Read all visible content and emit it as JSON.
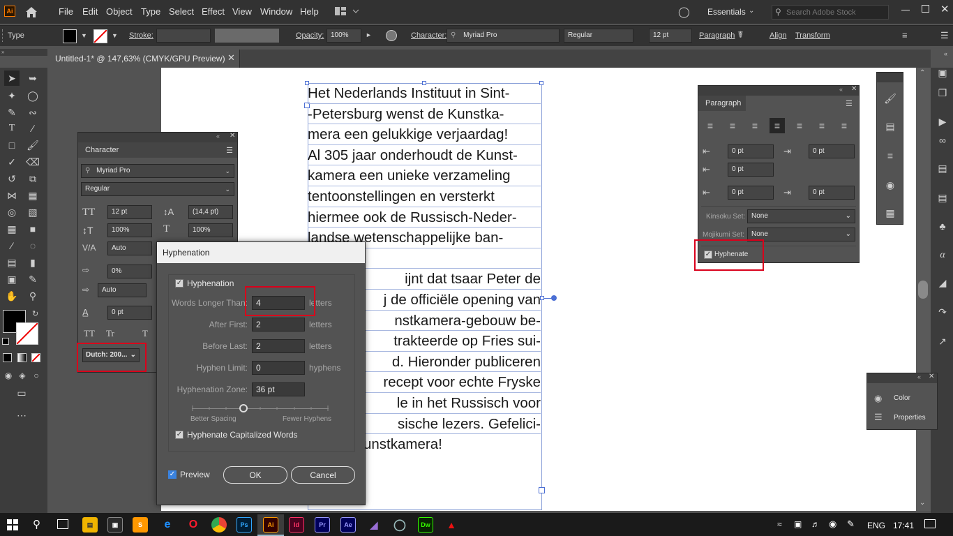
{
  "app": {
    "logo": "Ai",
    "workspace": "Essentials",
    "search_placeholder": "Search Adobe Stock"
  },
  "menu": [
    "File",
    "Edit",
    "Object",
    "Type",
    "Select",
    "Effect",
    "View",
    "Window",
    "Help"
  ],
  "control_bar": {
    "type_label": "Type",
    "stroke_label": "Stroke:",
    "opacity_label": "Opacity:",
    "opacity_value": "100%",
    "character_label": "Character:",
    "font": "Myriad Pro",
    "style": "Regular",
    "size": "12 pt",
    "paragraph_label": "Paragraph",
    "align_label": "Align",
    "transform_label": "Transform"
  },
  "document_tab": {
    "title": "Untitled-1* @ 147,63% (CMYK/GPU Preview)"
  },
  "artboard_text": [
    "Het Nederlands Instituut in Sint-",
    "-Petersburg wenst de Kunstka-",
    "mera een gelukkige verjaardag!",
    "Al 305 jaar onderhoudt de Kunst-",
    "kamera een unieke verzameling",
    "tentoonstellingen en versterkt",
    "hiermee ook de Russisch-Neder-",
    "landse wetenschappelijke ban-",
    "",
    "ijnt dat tsaar Peter de",
    "j de officiële opening van",
    "nstkamera-gebouw be-",
    "trakteerde op Fries sui-",
    "d. Hieronder publiceren",
    "recept voor echte Fryske",
    "le in het Russisch voor",
    "sische lezers. Gefelici-",
    "unstkamera!"
  ],
  "character_panel": {
    "title": "Character",
    "font": "Myriad Pro",
    "style": "Regular",
    "size": "12 pt",
    "leading": "(14,4 pt)",
    "vscale": "100%",
    "hscale": "100%",
    "kerning": "Auto",
    "tracking": "0%",
    "auto": "Auto",
    "baseline": "0 pt",
    "tt1": "TT",
    "tt2": "Tr",
    "language": "Dutch: 200..."
  },
  "hyphenation_dialog": {
    "title": "Hyphenation",
    "hyphenation_label": "Hyphenation",
    "rows": [
      {
        "label": "Words Longer Than:",
        "value": "4",
        "unit": "letters"
      },
      {
        "label": "After First:",
        "value": "2",
        "unit": "letters"
      },
      {
        "label": "Before Last:",
        "value": "2",
        "unit": "letters"
      },
      {
        "label": "Hyphen Limit:",
        "value": "0",
        "unit": "hyphens"
      },
      {
        "label": "Hyphenation Zone:",
        "value": "36 pt",
        "unit": ""
      }
    ],
    "better_spacing": "Better Spacing",
    "fewer_hyphens": "Fewer Hyphens",
    "slider_level": 0.38,
    "capitalized_label": "Hyphenate Capitalized Words",
    "preview_label": "Preview",
    "ok_label": "OK",
    "cancel_label": "Cancel"
  },
  "paragraph_panel": {
    "title": "Paragraph",
    "left_indent": "0 pt",
    "right_indent": "0 pt",
    "first_indent": "0 pt",
    "space_before": "0 pt",
    "space_after": "0 pt",
    "kinsoku_label": "Kinsoku Set:",
    "kinsoku_value": "None",
    "mojikumi_label": "Mojikumi Set:",
    "mojikumi_value": "None",
    "hyphenate_label": "Hyphenate"
  },
  "color_panel": {
    "color": "Color",
    "properties": "Properties"
  },
  "taskbar": {
    "language": "ENG",
    "time": "17:41"
  },
  "colors": {
    "accent_red": "#d9001b",
    "ai_orange": "#ff7c00"
  }
}
